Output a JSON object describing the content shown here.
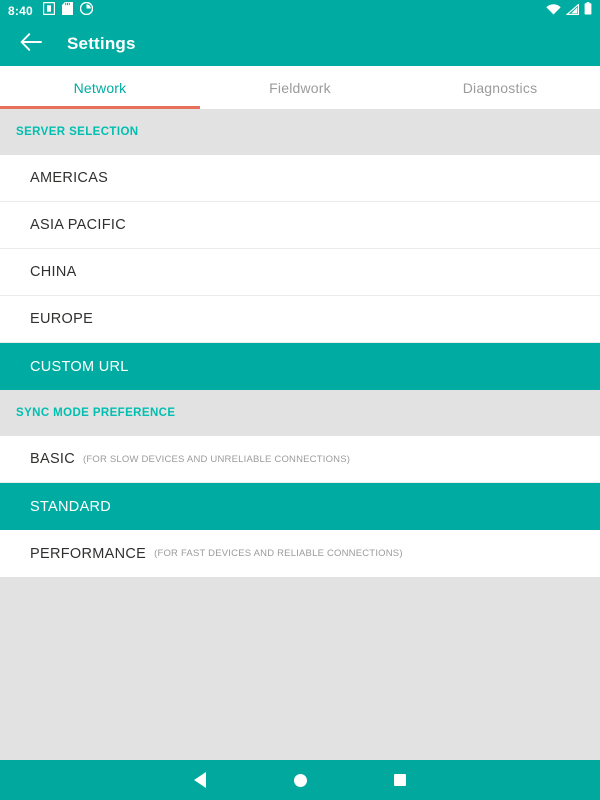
{
  "status_bar": {
    "clock": "8:40",
    "left_icons": [
      "sim-card-icon",
      "sd-card-icon",
      "data-usage-icon"
    ],
    "right_icons": [
      "wifi-icon",
      "cellular-signal-icon",
      "battery-icon"
    ],
    "background_color": "#00aca2"
  },
  "app_bar": {
    "back_icon": "arrow-back-icon",
    "title": "Settings",
    "background_color": "#00aca2",
    "title_color": "#ffffff"
  },
  "tabs": {
    "active_index": 0,
    "indicator_color": "#e8705a",
    "active_color": "#00aca2",
    "inactive_color": "#9b9b9b",
    "items": [
      {
        "label": "Network"
      },
      {
        "label": "Fieldwork"
      },
      {
        "label": "Diagnostics"
      }
    ]
  },
  "sections": [
    {
      "header": "SERVER SELECTION",
      "rows": [
        {
          "label": "AMERICAS",
          "hint": "",
          "selected": false
        },
        {
          "label": "ASIA PACIFIC",
          "hint": "",
          "selected": false
        },
        {
          "label": "CHINA",
          "hint": "",
          "selected": false
        },
        {
          "label": "EUROPE",
          "hint": "",
          "selected": false
        },
        {
          "label": "CUSTOM URL",
          "hint": "",
          "selected": true
        }
      ]
    },
    {
      "header": "SYNC MODE PREFERENCE",
      "rows": [
        {
          "label": "BASIC",
          "hint": "(FOR SLOW DEVICES AND UNRELIABLE CONNECTIONS)",
          "selected": false
        },
        {
          "label": "STANDARD",
          "hint": "",
          "selected": true
        },
        {
          "label": "PERFORMANCE",
          "hint": "(FOR FAST DEVICES AND RELIABLE CONNECTIONS)",
          "selected": false
        }
      ]
    }
  ],
  "nav_bar": {
    "background_color": "#00a89d",
    "buttons": [
      {
        "icon": "navigation-back-icon"
      },
      {
        "icon": "navigation-home-icon"
      },
      {
        "icon": "navigation-recents-icon"
      }
    ]
  },
  "colors": {
    "accent_teal": "#00aca2",
    "section_header_teal": "#00bfb0",
    "tab_underline_orange": "#e8705a",
    "page_background": "#e2e2e2",
    "row_background": "#ffffff"
  }
}
